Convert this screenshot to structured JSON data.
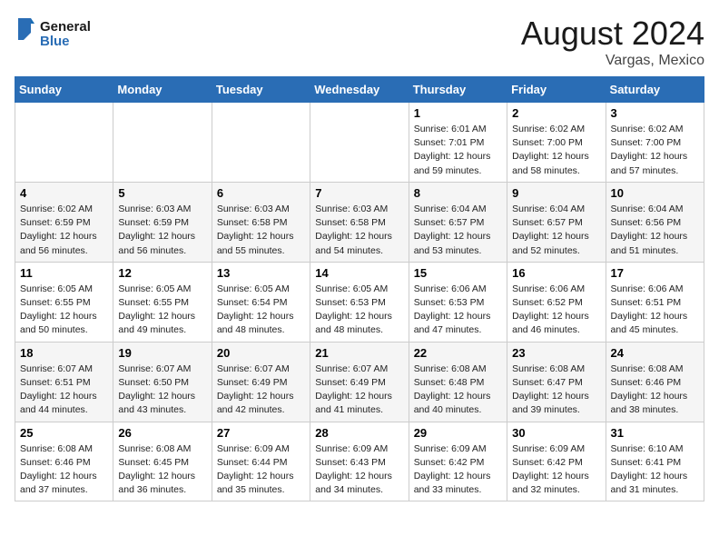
{
  "header": {
    "logo_line1": "General",
    "logo_line2": "Blue",
    "title": "August 2024",
    "subtitle": "Vargas, Mexico"
  },
  "weekdays": [
    "Sunday",
    "Monday",
    "Tuesday",
    "Wednesday",
    "Thursday",
    "Friday",
    "Saturday"
  ],
  "weeks": [
    [
      {
        "day": "",
        "info": ""
      },
      {
        "day": "",
        "info": ""
      },
      {
        "day": "",
        "info": ""
      },
      {
        "day": "",
        "info": ""
      },
      {
        "day": "1",
        "info": "Sunrise: 6:01 AM\nSunset: 7:01 PM\nDaylight: 12 hours\nand 59 minutes."
      },
      {
        "day": "2",
        "info": "Sunrise: 6:02 AM\nSunset: 7:00 PM\nDaylight: 12 hours\nand 58 minutes."
      },
      {
        "day": "3",
        "info": "Sunrise: 6:02 AM\nSunset: 7:00 PM\nDaylight: 12 hours\nand 57 minutes."
      }
    ],
    [
      {
        "day": "4",
        "info": "Sunrise: 6:02 AM\nSunset: 6:59 PM\nDaylight: 12 hours\nand 56 minutes."
      },
      {
        "day": "5",
        "info": "Sunrise: 6:03 AM\nSunset: 6:59 PM\nDaylight: 12 hours\nand 56 minutes."
      },
      {
        "day": "6",
        "info": "Sunrise: 6:03 AM\nSunset: 6:58 PM\nDaylight: 12 hours\nand 55 minutes."
      },
      {
        "day": "7",
        "info": "Sunrise: 6:03 AM\nSunset: 6:58 PM\nDaylight: 12 hours\nand 54 minutes."
      },
      {
        "day": "8",
        "info": "Sunrise: 6:04 AM\nSunset: 6:57 PM\nDaylight: 12 hours\nand 53 minutes."
      },
      {
        "day": "9",
        "info": "Sunrise: 6:04 AM\nSunset: 6:57 PM\nDaylight: 12 hours\nand 52 minutes."
      },
      {
        "day": "10",
        "info": "Sunrise: 6:04 AM\nSunset: 6:56 PM\nDaylight: 12 hours\nand 51 minutes."
      }
    ],
    [
      {
        "day": "11",
        "info": "Sunrise: 6:05 AM\nSunset: 6:55 PM\nDaylight: 12 hours\nand 50 minutes."
      },
      {
        "day": "12",
        "info": "Sunrise: 6:05 AM\nSunset: 6:55 PM\nDaylight: 12 hours\nand 49 minutes."
      },
      {
        "day": "13",
        "info": "Sunrise: 6:05 AM\nSunset: 6:54 PM\nDaylight: 12 hours\nand 48 minutes."
      },
      {
        "day": "14",
        "info": "Sunrise: 6:05 AM\nSunset: 6:53 PM\nDaylight: 12 hours\nand 48 minutes."
      },
      {
        "day": "15",
        "info": "Sunrise: 6:06 AM\nSunset: 6:53 PM\nDaylight: 12 hours\nand 47 minutes."
      },
      {
        "day": "16",
        "info": "Sunrise: 6:06 AM\nSunset: 6:52 PM\nDaylight: 12 hours\nand 46 minutes."
      },
      {
        "day": "17",
        "info": "Sunrise: 6:06 AM\nSunset: 6:51 PM\nDaylight: 12 hours\nand 45 minutes."
      }
    ],
    [
      {
        "day": "18",
        "info": "Sunrise: 6:07 AM\nSunset: 6:51 PM\nDaylight: 12 hours\nand 44 minutes."
      },
      {
        "day": "19",
        "info": "Sunrise: 6:07 AM\nSunset: 6:50 PM\nDaylight: 12 hours\nand 43 minutes."
      },
      {
        "day": "20",
        "info": "Sunrise: 6:07 AM\nSunset: 6:49 PM\nDaylight: 12 hours\nand 42 minutes."
      },
      {
        "day": "21",
        "info": "Sunrise: 6:07 AM\nSunset: 6:49 PM\nDaylight: 12 hours\nand 41 minutes."
      },
      {
        "day": "22",
        "info": "Sunrise: 6:08 AM\nSunset: 6:48 PM\nDaylight: 12 hours\nand 40 minutes."
      },
      {
        "day": "23",
        "info": "Sunrise: 6:08 AM\nSunset: 6:47 PM\nDaylight: 12 hours\nand 39 minutes."
      },
      {
        "day": "24",
        "info": "Sunrise: 6:08 AM\nSunset: 6:46 PM\nDaylight: 12 hours\nand 38 minutes."
      }
    ],
    [
      {
        "day": "25",
        "info": "Sunrise: 6:08 AM\nSunset: 6:46 PM\nDaylight: 12 hours\nand 37 minutes."
      },
      {
        "day": "26",
        "info": "Sunrise: 6:08 AM\nSunset: 6:45 PM\nDaylight: 12 hours\nand 36 minutes."
      },
      {
        "day": "27",
        "info": "Sunrise: 6:09 AM\nSunset: 6:44 PM\nDaylight: 12 hours\nand 35 minutes."
      },
      {
        "day": "28",
        "info": "Sunrise: 6:09 AM\nSunset: 6:43 PM\nDaylight: 12 hours\nand 34 minutes."
      },
      {
        "day": "29",
        "info": "Sunrise: 6:09 AM\nSunset: 6:42 PM\nDaylight: 12 hours\nand 33 minutes."
      },
      {
        "day": "30",
        "info": "Sunrise: 6:09 AM\nSunset: 6:42 PM\nDaylight: 12 hours\nand 32 minutes."
      },
      {
        "day": "31",
        "info": "Sunrise: 6:10 AM\nSunset: 6:41 PM\nDaylight: 12 hours\nand 31 minutes."
      }
    ]
  ]
}
